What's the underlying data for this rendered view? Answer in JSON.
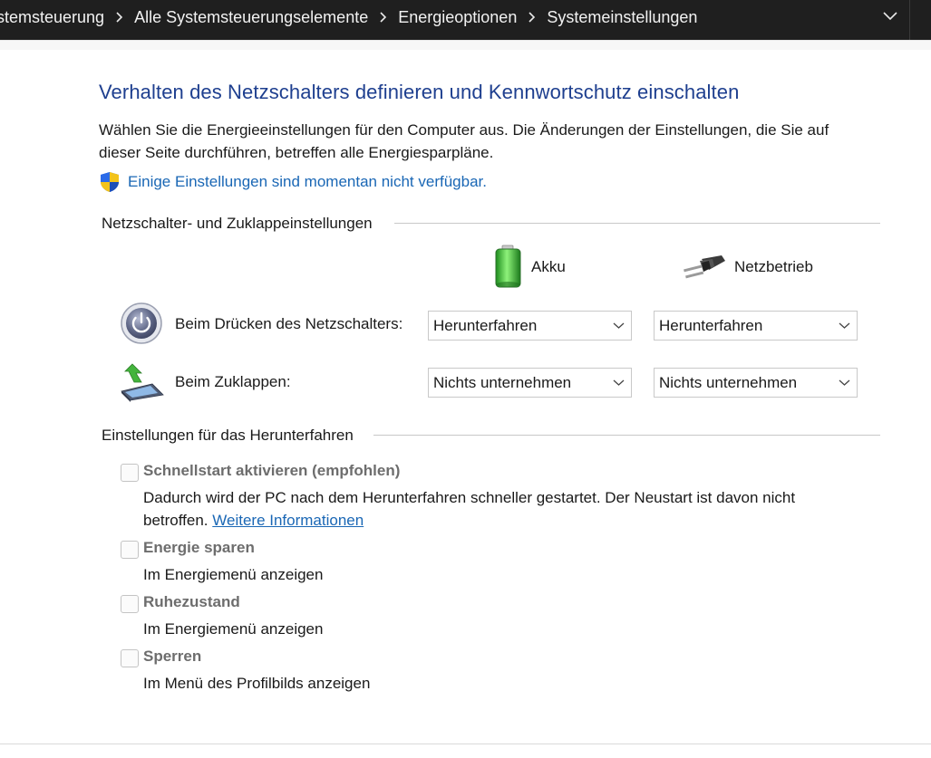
{
  "breadcrumb": {
    "items": [
      "stemsteuerung",
      "Alle Systemsteuerungselemente",
      "Energieoptionen",
      "Systemeinstellungen"
    ]
  },
  "page": {
    "title": "Verhalten des Netzschalters definieren und Kennwortschutz einschalten",
    "description_line1": "Wählen Sie die Energieeinstellungen für den Computer aus. Die Änderungen der Einstellungen, die Sie auf",
    "description_line2": "dieser Seite durchführen, betreffen alle Energiesparpläne.",
    "unavailable_link": "Einige Einstellungen sind momentan nicht verfügbar."
  },
  "power_buttons": {
    "group_title": "Netzschalter- und Zuklappeinstellungen",
    "col_battery": "Akku",
    "col_plugged": "Netzbetrieb",
    "rows": [
      {
        "label": "Beim Drücken des Netzschalters:",
        "battery": "Herunterfahren",
        "plugged": "Herunterfahren"
      },
      {
        "label": "Beim Zuklappen:",
        "battery": "Nichts unternehmen",
        "plugged": "Nichts unternehmen"
      }
    ]
  },
  "shutdown": {
    "group_title": "Einstellungen für das Herunterfahren",
    "options": [
      {
        "title": "Schnellstart aktivieren (empfohlen)",
        "desc_line1": "Dadurch wird der PC nach dem Herunterfahren schneller gestartet. Der Neustart ist davon nicht",
        "desc_line2": "betroffen.",
        "link": "Weitere Informationen",
        "checked": false
      },
      {
        "title": "Energie sparen",
        "desc": "Im Energiemenü anzeigen",
        "checked": false
      },
      {
        "title": "Ruhezustand",
        "desc": "Im Energiemenü anzeigen",
        "checked": false
      },
      {
        "title": "Sperren",
        "desc": "Im Menü des Profilbilds anzeigen",
        "checked": false
      }
    ]
  },
  "colors": {
    "title": "#1e3f8f",
    "link": "#1a67b5",
    "topbar": "#1f1f1f"
  }
}
